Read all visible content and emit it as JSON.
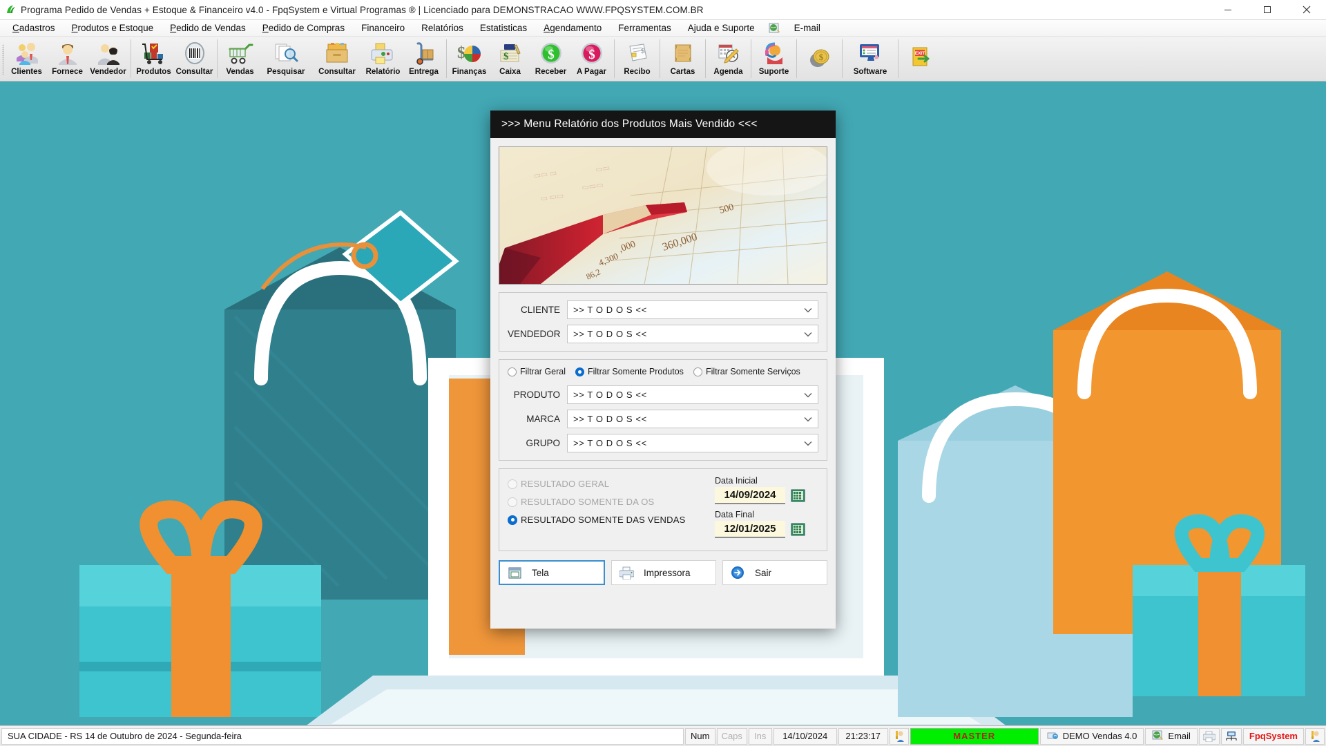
{
  "window": {
    "title": "Programa Pedido de Vendas + Estoque & Financeiro v4.0 - FpqSystem e Virtual Programas ® | Licenciado para  DEMONSTRACAO WWW.FPQSYSTEM.COM.BR",
    "app_icon": "fpq-logo-icon",
    "minimize": "–",
    "maximize": "□",
    "close": "✕"
  },
  "menubar": {
    "items": [
      {
        "label": "Cadastros",
        "accel": "C"
      },
      {
        "label": "Produtos e Estoque",
        "accel": "P"
      },
      {
        "label": "Pedido de Vendas",
        "accel": "P"
      },
      {
        "label": "Pedido de Compras",
        "accel": "P"
      },
      {
        "label": "Financeiro",
        "accel": ""
      },
      {
        "label": "Relatórios",
        "accel": ""
      },
      {
        "label": "Estatisticas",
        "accel": ""
      },
      {
        "label": "Agendamento",
        "accel": "A"
      },
      {
        "label": "Ferramentas",
        "accel": ""
      },
      {
        "label": "Ajuda e Suporte",
        "accel": ""
      },
      {
        "label": "E-mail",
        "accel": ""
      }
    ]
  },
  "toolbar": {
    "groups": [
      {
        "buttons": [
          {
            "label": "Clientes",
            "icon": "clients-group-icon"
          },
          {
            "label": "Fornece",
            "icon": "supplier-person-icon"
          },
          {
            "label": "Vendedor",
            "icon": "salesperson-icon"
          }
        ]
      },
      {
        "buttons": [
          {
            "label": "Produtos",
            "icon": "product-cart-icon"
          },
          {
            "label": "Consultar",
            "icon": "barcode-icon"
          }
        ]
      },
      {
        "buttons": [
          {
            "label": "Vendas",
            "icon": "shopping-cart-icon"
          },
          {
            "label": "Pesquisar",
            "icon": "search-documents-icon"
          },
          {
            "label": "Consultar",
            "icon": "file-drawer-icon"
          },
          {
            "label": "Relatório",
            "icon": "report-printer-icon"
          },
          {
            "label": "Entrega",
            "icon": "delivery-dolly-icon"
          }
        ]
      },
      {
        "buttons": [
          {
            "label": "Finanças",
            "icon": "finance-piechart-icon"
          },
          {
            "label": "Caixa",
            "icon": "cashbook-icon"
          },
          {
            "label": "Receber",
            "icon": "green-dollar-icon"
          },
          {
            "label": "A Pagar",
            "icon": "red-dollar-icon"
          }
        ]
      },
      {
        "buttons": [
          {
            "label": "Recibo",
            "icon": "receipt-icon"
          }
        ]
      },
      {
        "buttons": [
          {
            "label": "Cartas",
            "icon": "scroll-letter-icon"
          }
        ]
      },
      {
        "buttons": [
          {
            "label": "Agenda",
            "icon": "calendar-clock-icon"
          }
        ]
      },
      {
        "buttons": [
          {
            "label": "Suporte",
            "icon": "headset-support-icon"
          }
        ]
      },
      {
        "buttons": [
          {
            "label": "",
            "icon": "coin-stack-icon"
          }
        ]
      },
      {
        "buttons": [
          {
            "label": "Software",
            "icon": "software-monitor-icon"
          }
        ]
      },
      {
        "buttons": [
          {
            "label": "",
            "icon": "exit-door-icon"
          }
        ]
      }
    ]
  },
  "dialog": {
    "title": ">>> Menu Relatório dos Produtos Mais Vendido <<<",
    "banner_icon": "pencil-on-ledger-photo",
    "filters_top": [
      {
        "label": "CLIENTE",
        "value": ">> T O D O S <<",
        "name": "cliente"
      },
      {
        "label": "VENDEDOR",
        "value": ">> T O D O S <<",
        "name": "vendedor"
      }
    ],
    "filter_mode": {
      "options": [
        {
          "label": "Filtrar Geral",
          "selected": false,
          "disabled": false
        },
        {
          "label": "Filtrar Somente Produtos",
          "selected": true,
          "disabled": false
        },
        {
          "label": "Filtrar Somente Serviços",
          "selected": false,
          "disabled": false
        }
      ]
    },
    "filters_product": [
      {
        "label": "PRODUTO",
        "value": ">> T O D O S <<",
        "name": "produto"
      },
      {
        "label": "MARCA",
        "value": ">> T O D O S <<",
        "name": "marca"
      },
      {
        "label": "GRUPO",
        "value": ">> T O D O S <<",
        "name": "grupo"
      }
    ],
    "result_mode": {
      "options": [
        {
          "label": "RESULTADO GERAL",
          "selected": false,
          "disabled": true
        },
        {
          "label": "RESULTADO SOMENTE DA OS",
          "selected": false,
          "disabled": true
        },
        {
          "label": "RESULTADO SOMENTE DAS VENDAS",
          "selected": true,
          "disabled": false
        }
      ]
    },
    "dates": {
      "initial_label": "Data Inicial",
      "initial_value": "14/09/2024",
      "final_label": "Data Final",
      "final_value": "12/01/2025",
      "calendar_icon": "calendar-icon"
    },
    "buttons": [
      {
        "label": "Tela",
        "icon": "screen-window-icon",
        "focused": true
      },
      {
        "label": "Impressora",
        "icon": "printer-icon",
        "focused": false
      },
      {
        "label": "Sair",
        "icon": "exit-arrow-icon",
        "focused": false
      }
    ]
  },
  "statusbar": {
    "message": "SUA CIDADE - RS 14 de Outubro de 2024 - Segunda-feira",
    "num": "Num",
    "caps": "Caps",
    "ins": "Ins",
    "date": "14/10/2024",
    "time": "21:23:17",
    "user_icon": "user-key-icon",
    "master": "MASTER",
    "demo_icon": "demo-icon",
    "demo": "DEMO Vendas 4.0",
    "email_icon": "email-globe-icon",
    "email": "Email",
    "printer_icon": "printer-icon",
    "network_icon": "network-icon",
    "brand": "FpqSystem",
    "brand_icon": "user-key-icon"
  },
  "colors": {
    "desktop": "#42a8b4",
    "dialog_title_bg": "#151515",
    "accent_blue": "#0a6ed1",
    "master_green": "#00ee00",
    "master_text": "#b42020",
    "date_field_bg": "#fbf8dd",
    "brand_red": "#e31414"
  }
}
